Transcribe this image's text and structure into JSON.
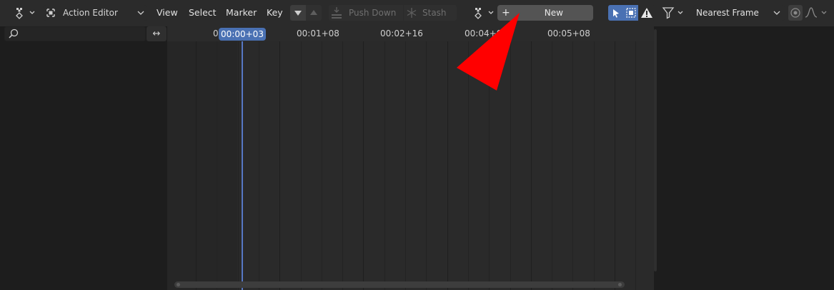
{
  "header": {
    "mode_label": "Action Editor",
    "menus": [
      "View",
      "Select",
      "Marker",
      "Key"
    ],
    "push_down_label": "Push Down",
    "stash_label": "Stash",
    "plus_label": "+",
    "new_label": "New",
    "snap_label": "Nearest Frame"
  },
  "ruler": {
    "labels": [
      "0",
      "00:00+03",
      "00:01+08",
      "00:02+16",
      "00:04+0",
      "00:05+08"
    ],
    "current_frame": "00:00+03"
  },
  "colors": {
    "accent": "#4a71b3",
    "playhead": "#5778c4",
    "annotation_arrow": "#ff0000"
  }
}
